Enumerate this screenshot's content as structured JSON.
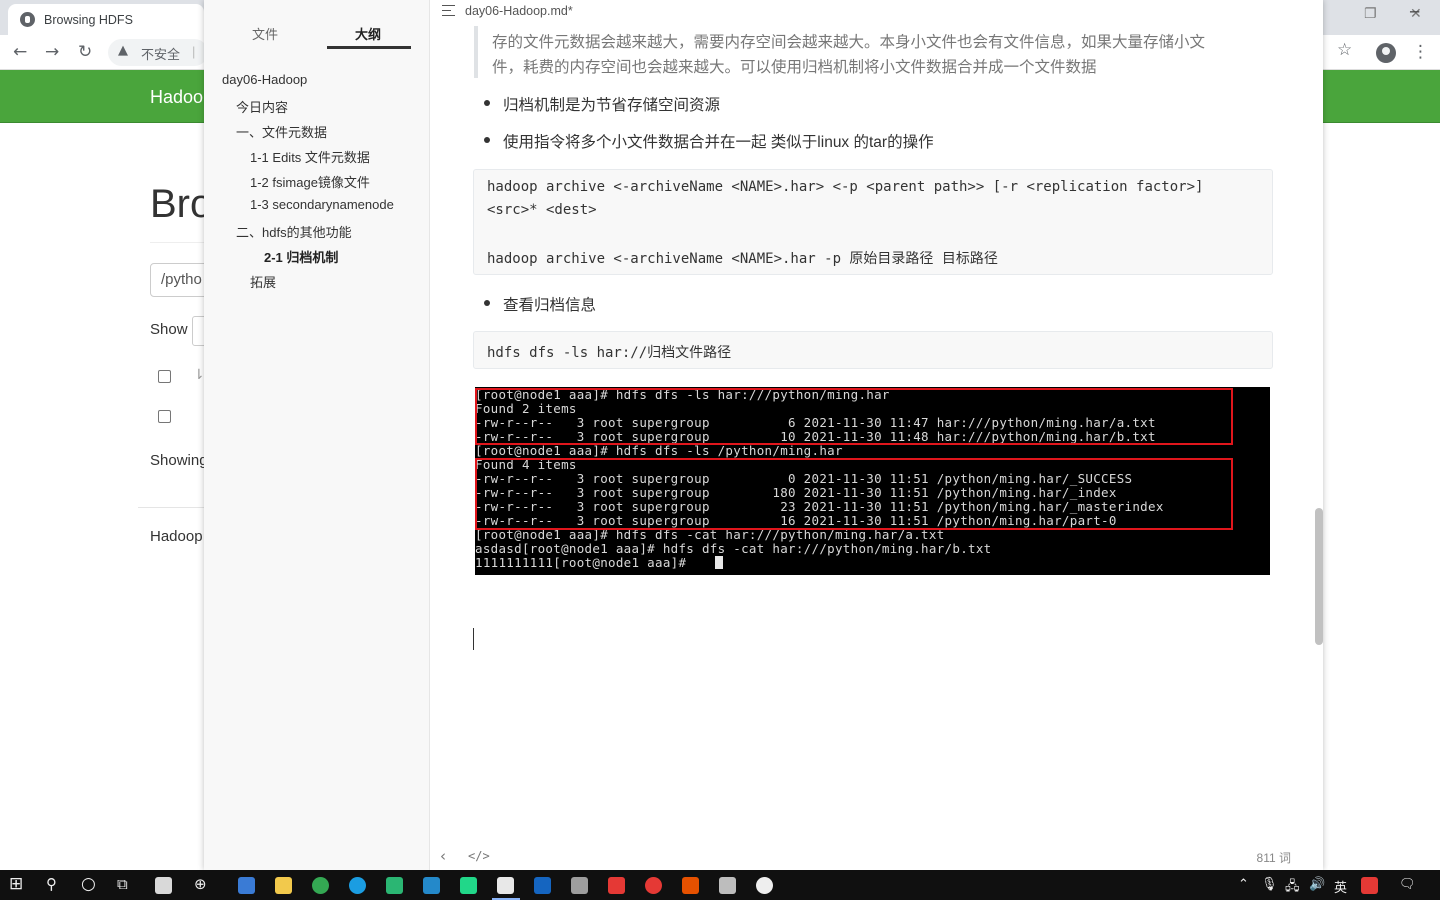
{
  "browser": {
    "tab_title": "Browsing HDFS",
    "address_security": "不安全",
    "address_separator": "|",
    "hdfs": {
      "brand": "Hadoo",
      "heading": "Bro",
      "path_value": "/pytho",
      "show_label": "Show",
      "showing_label": "Showing",
      "footer": "Hadoop"
    }
  },
  "typora": {
    "window_title": "day06-Hadoop.md*",
    "sidebar": {
      "tab_files": "文件",
      "tab_outline": "大纲",
      "outline": [
        {
          "label": "day06-Hadoop",
          "level": 1
        },
        {
          "label": "今日内容",
          "level": 2
        },
        {
          "label": "一、文件元数据",
          "level": 2
        },
        {
          "label": "1-1 Edits 文件元数据",
          "level": 3
        },
        {
          "label": "1-2 fsimage镜像文件",
          "level": 3
        },
        {
          "label": "1-3 secondarynamenode",
          "level": 3
        },
        {
          "label": "二、hdfs的其他功能",
          "level": 2
        },
        {
          "label": "2-1 归档机制",
          "level": 4,
          "active": true
        },
        {
          "label": "拓展",
          "level": 3
        }
      ]
    },
    "content": {
      "blockquote": [
        "存的文件元数据会越来越大，需要内存空间会越来越大。本身小文件也会有文件信息，如果大量存储小文",
        "件，耗费的内存空间也会越来越大。可以使用归档机制将小文件数据合并成一个文件数据"
      ],
      "bullets": [
        "归档机制是为节省存储空间资源",
        "使用指令将多个小文件数据合并在一起  类似于linux 的tar的操作",
        "查看归档信息"
      ],
      "code1": [
        "hadoop archive <-archiveName <NAME>.har> <-p <parent path>> [-r <replication factor>]",
        "<src>* <dest>",
        "",
        "hadoop archive  <-archiveName <NAME>.har  -p  原始目录路径   目标路径"
      ],
      "code2": "hdfs dfs -ls har://归档文件路径",
      "terminal": [
        "[root@node1 aaa]# hdfs dfs -ls har:///python/ming.har",
        "Found 2 items",
        "-rw-r--r--   3 root supergroup          6 2021-11-30 11:47 har:///python/ming.har/a.txt",
        "-rw-r--r--   3 root supergroup         10 2021-11-30 11:48 har:///python/ming.har/b.txt",
        "[root@node1 aaa]# hdfs dfs -ls /python/ming.har",
        "Found 4 items",
        "-rw-r--r--   3 root supergroup          0 2021-11-30 11:51 /python/ming.har/_SUCCESS",
        "-rw-r--r--   3 root supergroup        180 2021-11-30 11:51 /python/ming.har/_index",
        "-rw-r--r--   3 root supergroup         23 2021-11-30 11:51 /python/ming.har/_masterindex",
        "-rw-r--r--   3 root supergroup         16 2021-11-30 11:51 /python/ming.har/part-0",
        "[root@node1 aaa]# hdfs dfs -cat har:///python/ming.har/a.txt",
        "asdasd[root@node1 aaa]# hdfs dfs -cat har:///python/ming.har/b.txt",
        "1111111111[root@node1 aaa]# "
      ]
    },
    "status": {
      "word_count": "811 词",
      "source_toggle": "</>"
    }
  },
  "taskbar": {
    "ime_lang": "英"
  },
  "colors": {
    "hdfs_nav": "#4aa53c",
    "terminal_bg": "#000000",
    "highlight_box": "#e0161c"
  }
}
